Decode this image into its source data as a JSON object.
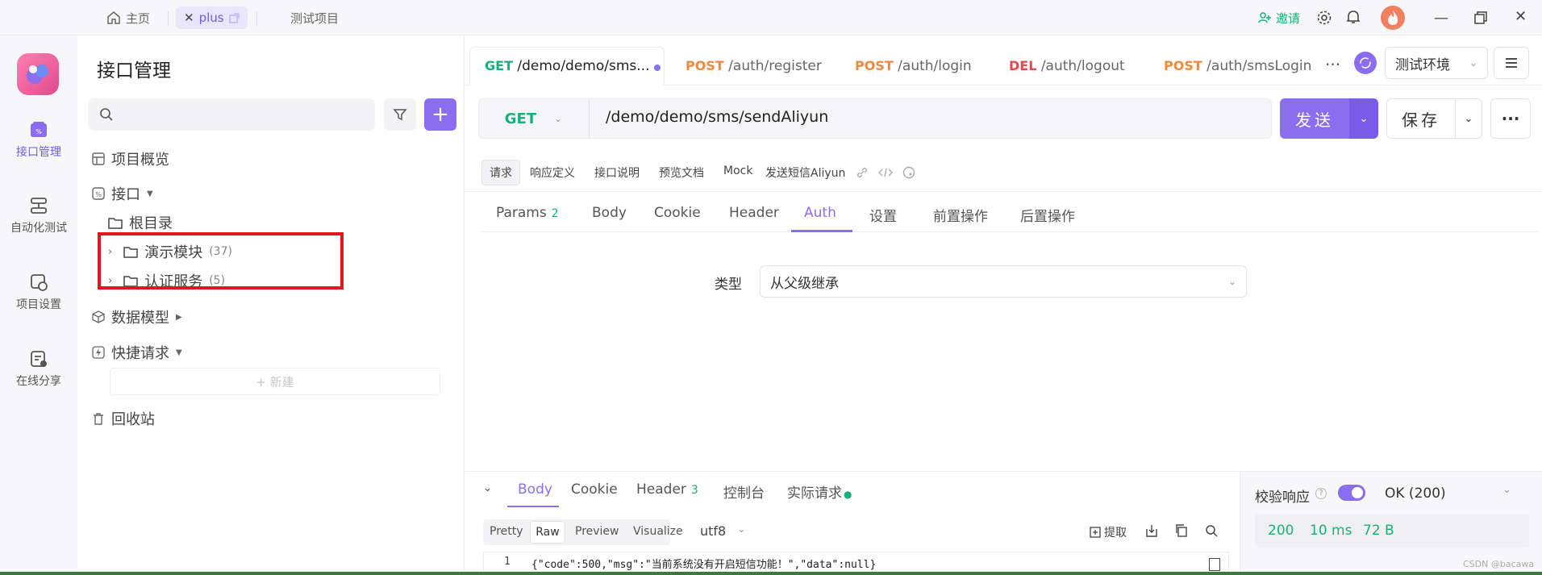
{
  "titlebar": {
    "home_label": "主页",
    "tab_plus_label": "plus",
    "project_label": "测试项目",
    "invite_label": "邀请"
  },
  "nav": {
    "items": [
      {
        "label": "接口管理",
        "icon": "api-icon",
        "active": true
      },
      {
        "label": "自动化测试",
        "icon": "automation-icon",
        "active": false
      },
      {
        "label": "项目设置",
        "icon": "settings-icon",
        "active": false
      },
      {
        "label": "在线分享",
        "icon": "share-icon",
        "active": false
      }
    ]
  },
  "sidebar": {
    "title": "接口管理",
    "search_placeholder": "",
    "overview_label": "项目概览",
    "api_label": "接口",
    "root_label": "根目录",
    "folders": [
      {
        "label": "演示模块",
        "count": "(37)"
      },
      {
        "label": "认证服务",
        "count": "(5)"
      }
    ],
    "data_model_label": "数据模型",
    "quick_request_label": "快捷请求",
    "new_label": "+ 新建",
    "trash_label": "回收站"
  },
  "request_tabs": [
    {
      "method": "GET",
      "path": "/demo/demo/sms..."
    },
    {
      "method": "POST",
      "path": "/auth/register"
    },
    {
      "method": "POST",
      "path": "/auth/login"
    },
    {
      "method": "DEL",
      "path": "/auth/logout"
    },
    {
      "method": "POST",
      "path": "/auth/smsLogin"
    }
  ],
  "more_label": "···",
  "env": {
    "selected": "测试环境"
  },
  "url_bar": {
    "method": "GET",
    "url": "/demo/demo/sms/sendAliyun",
    "send_label": "发送",
    "save_label": "保存"
  },
  "sub_tabs": [
    "请求",
    "响应定义",
    "接口说明",
    "预览文档",
    "Mock",
    "发送短信Aliyun"
  ],
  "param_tabs": [
    {
      "label": "Params",
      "badge": "2"
    },
    {
      "label": "Body",
      "badge": ""
    },
    {
      "label": "Cookie",
      "badge": ""
    },
    {
      "label": "Header",
      "badge": ""
    },
    {
      "label": "Auth",
      "badge": ""
    },
    {
      "label": "设置",
      "badge": ""
    },
    {
      "label": "前置操作",
      "badge": ""
    },
    {
      "label": "后置操作",
      "badge": ""
    }
  ],
  "auth": {
    "type_label": "类型",
    "type_value": "从父级继承"
  },
  "response": {
    "tabs": [
      {
        "label": "Body",
        "badge": ""
      },
      {
        "label": "Cookie",
        "badge": ""
      },
      {
        "label": "Header",
        "badge": "3"
      },
      {
        "label": "控制台",
        "badge": ""
      },
      {
        "label": "实际请求",
        "badge": ""
      }
    ],
    "view_modes": [
      "Pretty",
      "Raw",
      "Preview",
      "Visualize"
    ],
    "encoding": "utf8",
    "extract_label": "提取",
    "line_number": "1",
    "body_text": "{\"code\":500,\"msg\":\"当前系统没有开启短信功能！\",\"data\":null}",
    "validate_label": "校验响应",
    "ok_label": "OK (200)",
    "status": "200",
    "time": "10 ms",
    "size": "72 B"
  },
  "watermark": "CSDN @bacawa",
  "colors": {
    "accent": "#8b6ef0",
    "get": "#18b07a",
    "post": "#f0883e",
    "del": "#e5484d",
    "highlight_box": "#e8141b"
  }
}
